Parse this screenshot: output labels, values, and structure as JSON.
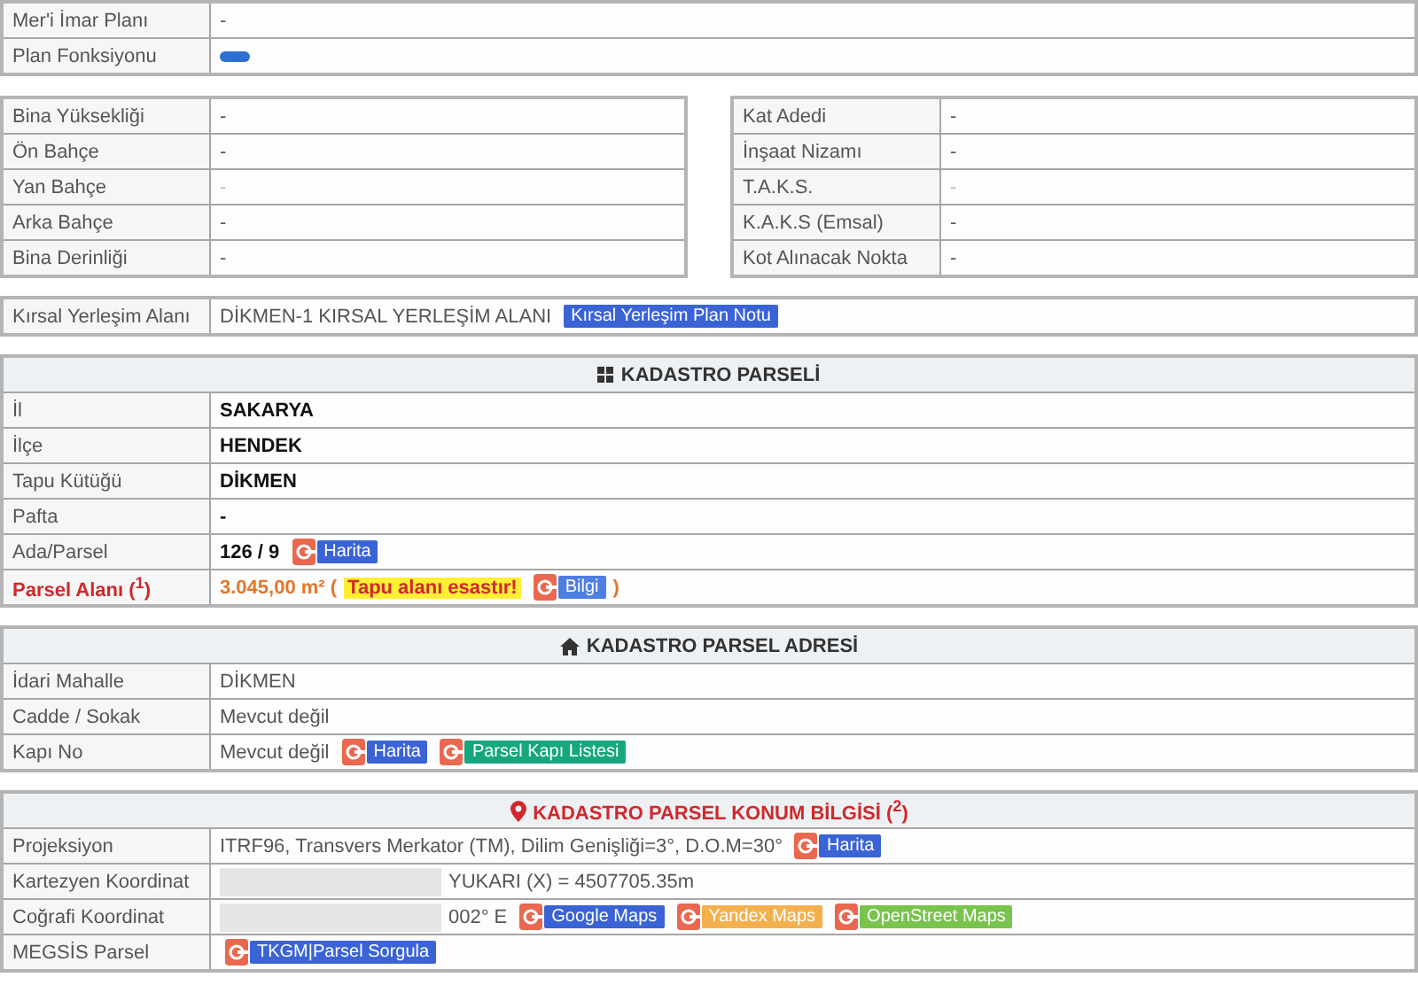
{
  "sections": [
    {
      "kind": "table",
      "rows": [
        {
          "label": "Mer'i İmar Planı",
          "value": [
            {
              "kind": "plain",
              "text": "-"
            }
          ]
        },
        {
          "label": "Plan Fonksiyonu",
          "value": [
            {
              "kind": "swatch",
              "color": "#2f6fd0"
            }
          ]
        }
      ]
    },
    {
      "kind": "pair",
      "left": [
        {
          "label": "Bina Yüksekliği",
          "value": [
            {
              "kind": "plain",
              "text": "-"
            }
          ]
        },
        {
          "label": "Ön Bahçe",
          "value": [
            {
              "kind": "plain",
              "text": "-"
            }
          ]
        },
        {
          "label": "Yan Bahçe",
          "value": [
            {
              "kind": "muted",
              "text": "-"
            }
          ]
        },
        {
          "label": "Arka Bahçe",
          "value": [
            {
              "kind": "plain",
              "text": "-"
            }
          ]
        },
        {
          "label": "Bina Derinliği",
          "value": [
            {
              "kind": "plain",
              "text": "-"
            }
          ]
        }
      ],
      "right": [
        {
          "label": "Kat Adedi",
          "value": [
            {
              "kind": "plain",
              "text": "-"
            }
          ]
        },
        {
          "label": "İnşaat Nizamı",
          "value": [
            {
              "kind": "plain",
              "text": "-"
            }
          ]
        },
        {
          "label": "T.A.K.S.",
          "value": [
            {
              "kind": "muted",
              "text": "-"
            }
          ]
        },
        {
          "label": "K.A.K.S (Emsal)",
          "value": [
            {
              "kind": "plain",
              "text": "-"
            }
          ]
        },
        {
          "label": "Kot Alınacak Nokta",
          "value": [
            {
              "kind": "plain",
              "text": "-"
            }
          ]
        }
      ]
    },
    {
      "kind": "table",
      "rows": [
        {
          "label": "Kırsal Yerleşim Alanı",
          "value": [
            {
              "kind": "plain",
              "text": "DİKMEN-1 KIRSAL YERLEŞİM ALANI"
            },
            {
              "kind": "tag",
              "text": "Kırsal Yerleşim Plan Notu",
              "color": "#3a63d6"
            }
          ]
        }
      ]
    },
    {
      "kind": "table",
      "header": {
        "title": "KADASTRO PARSELİ",
        "alert": false
      },
      "rows": [
        {
          "label": "İl",
          "value": [
            {
              "kind": "strong",
              "text": "SAKARYA"
            }
          ]
        },
        {
          "label": "İlçe",
          "value": [
            {
              "kind": "strong",
              "text": "HENDEK"
            }
          ]
        },
        {
          "label": "Tapu Kütüğü",
          "value": [
            {
              "kind": "strong",
              "text": "DİKMEN"
            }
          ]
        },
        {
          "label": "Pafta",
          "value": [
            {
              "kind": "strong",
              "text": "-"
            }
          ]
        },
        {
          "label": "Ada/Parsel",
          "value": [
            {
              "kind": "strong",
              "text": "126 / 9"
            },
            {
              "kind": "link",
              "text": "Harita",
              "color": "#3a63d6"
            }
          ]
        },
        {
          "label": "Parsel Alanı ($^{1}$)",
          "alert": true,
          "value": [
            {
              "kind": "alert",
              "text": "3.045,00 m² ("
            },
            {
              "kind": "highlight",
              "text": "Tapu alanı esastır!"
            },
            {
              "kind": "link",
              "text": "Bilgi",
              "color": "#4f7fe0"
            },
            {
              "kind": "alert",
              "text": ")"
            }
          ]
        }
      ]
    },
    {
      "kind": "table",
      "header": {
        "title": "KADASTRO PARSEL ADRESİ",
        "alert": false
      },
      "rows": [
        {
          "label": "İdari Mahalle",
          "value": [
            {
              "kind": "plain",
              "text": "DİKMEN"
            }
          ]
        },
        {
          "label": "Cadde / Sokak",
          "value": [
            {
              "kind": "plain",
              "text": "Mevcut değil"
            }
          ]
        },
        {
          "label": "Kapı No",
          "value": [
            {
              "kind": "plain",
              "text": "Mevcut değil"
            },
            {
              "kind": "link",
              "text": "Harita",
              "color": "#3a63d6"
            },
            {
              "kind": "link",
              "text": "Parsel Kapı Listesi",
              "color": "#16a77e"
            }
          ]
        }
      ]
    },
    {
      "kind": "table",
      "header": {
        "title": "KADASTRO PARSEL KONUM BİLGİSİ ($^{2}$)",
        "alert": true
      },
      "rows": [
        {
          "label": "Projeksiyon",
          "value": [
            {
              "kind": "plain",
              "text": "ITRF96, Transvers Merkator (TM), Dilim Genişliği=3°, D.O.M=30°"
            },
            {
              "kind": "link",
              "text": "Harita",
              "color": "#3a63d6"
            }
          ]
        },
        {
          "label": "Kartezyen Koordinat",
          "value": [
            {
              "kind": "redaction"
            },
            {
              "kind": "plain",
              "text": "YUKARI (X) = 4507705.35m"
            }
          ]
        },
        {
          "label": "Coğrafi Koordinat",
          "value": [
            {
              "kind": "redaction"
            },
            {
              "kind": "plain",
              "text": "002° E"
            },
            {
              "kind": "link",
              "text": "Google Maps",
              "color": "#3a63d6"
            },
            {
              "kind": "link",
              "text": "Yandex Maps",
              "color": "#f5b04e"
            },
            {
              "kind": "link",
              "text": "OpenStreet Maps",
              "color": "#78c44c"
            }
          ]
        },
        {
          "label": "MEGSİS Parsel",
          "value": [
            {
              "kind": "link",
              "text": "TKGM|Parsel Sorgula",
              "color": "#3a63d6"
            }
          ]
        }
      ]
    }
  ]
}
